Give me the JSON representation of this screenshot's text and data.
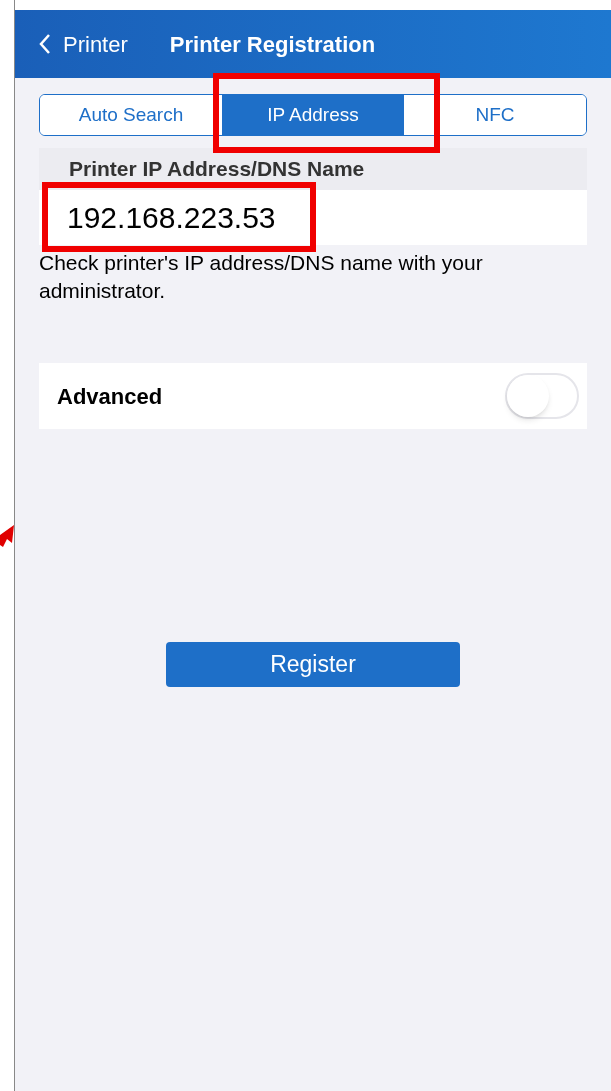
{
  "nav_bar": {
    "back_label": "Printer",
    "title": "Printer Registration"
  },
  "tabs": [
    {
      "label": "Auto Search",
      "selected": false,
      "highlighted": false
    },
    {
      "label": "IP Address",
      "selected": true,
      "highlighted": true
    },
    {
      "label": "NFC",
      "selected": false,
      "highlighted": false
    }
  ],
  "address_section": {
    "header": "Printer IP Address/DNS Name",
    "value": "192.168.223.53",
    "highlighted": true,
    "hint": "Check printer's IP address/DNS name with your administrator."
  },
  "advanced": {
    "label": "Advanced",
    "on": false
  },
  "register_button": "Register"
}
